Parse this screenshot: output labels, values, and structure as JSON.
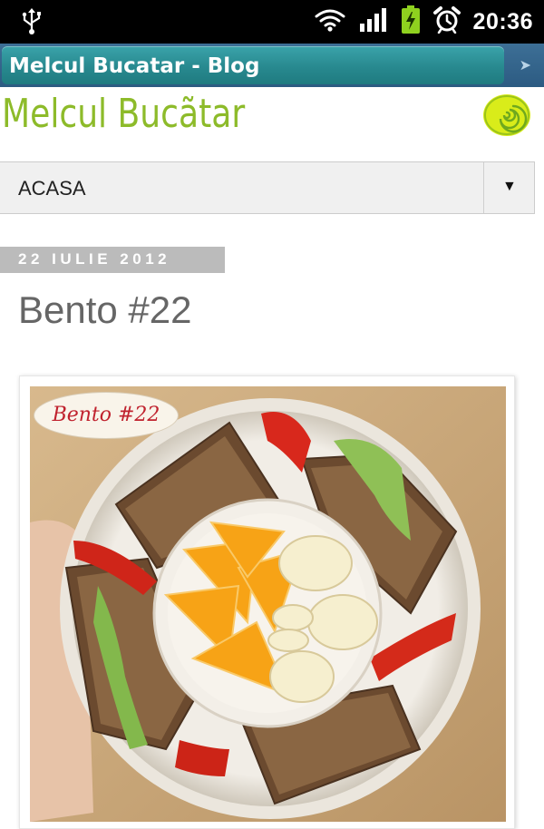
{
  "status_bar": {
    "time": "20:36",
    "icons": [
      "usb-icon",
      "wifi-icon",
      "signal-icon",
      "battery-charging-icon",
      "alarm-icon"
    ]
  },
  "browser": {
    "window_title": "Melcul Bucatar - Blog"
  },
  "blog": {
    "title": "Melcul Bucãtar",
    "title_color": "#8dbb2a",
    "logo": "snail-spiral-logo"
  },
  "nav": {
    "selected": "ACASA",
    "caret": "▼"
  },
  "post": {
    "date": "22 IULIE 2012",
    "title": "Bento #22",
    "photo": {
      "label": "Bento #22",
      "description_icon": "bento-box-photo"
    }
  }
}
